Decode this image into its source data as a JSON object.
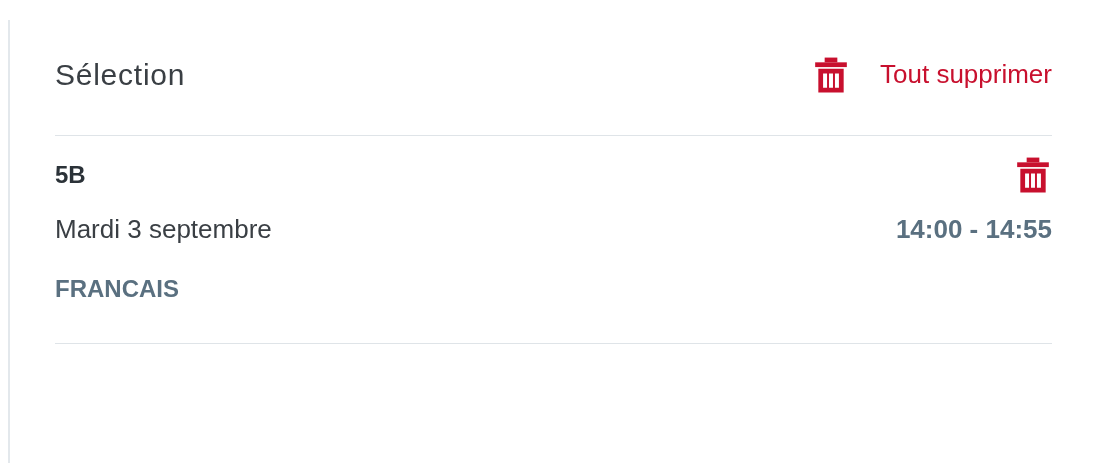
{
  "selection": {
    "title": "Sélection",
    "clear_all": "Tout supprimer"
  },
  "items": [
    {
      "class": "5B",
      "date": "Mardi 3 septembre",
      "time": "14:00 - 14:55",
      "subject": "FRANCAIS"
    }
  ]
}
